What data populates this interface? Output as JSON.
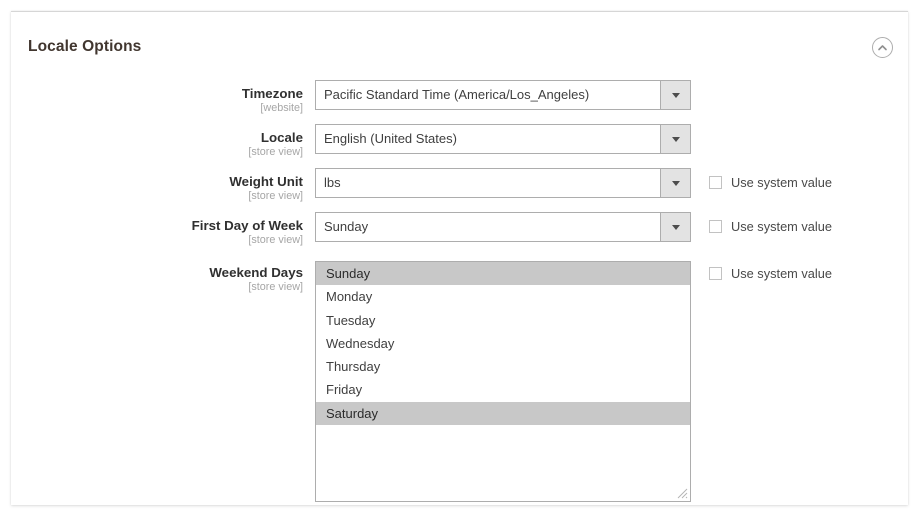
{
  "panel": {
    "title": "Locale Options",
    "collapse_icon": "chevron-up-circle-icon"
  },
  "fields": [
    {
      "label": "Timezone",
      "scope": "[website]",
      "value": "Pacific Standard Time (America/Los_Angeles)",
      "type": "select",
      "has_system_value": false
    },
    {
      "label": "Locale",
      "scope": "[store view]",
      "value": "English (United States)",
      "type": "select",
      "has_system_value": false
    },
    {
      "label": "Weight Unit",
      "scope": "[store view]",
      "value": "lbs",
      "type": "select",
      "has_system_value": true,
      "system_value_label": "Use system value",
      "system_value_checked": false
    },
    {
      "label": "First Day of Week",
      "scope": "[store view]",
      "value": "Sunday",
      "type": "select",
      "has_system_value": true,
      "system_value_label": "Use system value",
      "system_value_checked": false
    },
    {
      "label": "Weekend Days",
      "scope": "[store view]",
      "type": "multiselect",
      "has_system_value": true,
      "system_value_label": "Use system value",
      "system_value_checked": false,
      "options": [
        {
          "label": "Sunday",
          "selected": true
        },
        {
          "label": "Monday",
          "selected": false
        },
        {
          "label": "Tuesday",
          "selected": false
        },
        {
          "label": "Wednesday",
          "selected": false
        },
        {
          "label": "Thursday",
          "selected": false
        },
        {
          "label": "Friday",
          "selected": false
        },
        {
          "label": "Saturday",
          "selected": true
        }
      ]
    }
  ],
  "colors": {
    "panel_background": "#ffffff",
    "border": "#adadad",
    "title_text": "#41362f",
    "label_text": "#303030",
    "scope_text": "#a6a6a6",
    "value_text": "#3f3f3f",
    "select_button": "#e3e3e3",
    "option_selected": "#c8c8c8"
  }
}
